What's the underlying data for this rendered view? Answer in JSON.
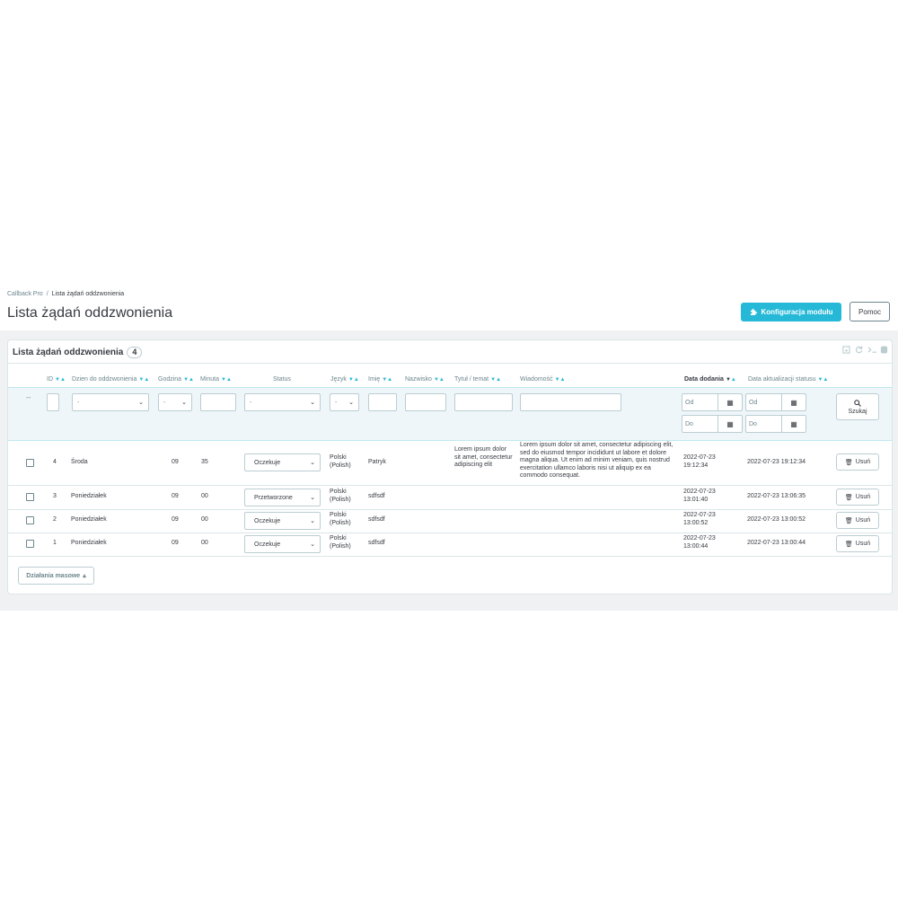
{
  "breadcrumb": {
    "parent": "Callback Pro",
    "separator": "/",
    "current": "Lista żądań oddzwonienia"
  },
  "page_title": "Lista żądań oddzwonienia",
  "toolbar": {
    "config_label": "Konfiguracja modułu",
    "help_label": "Pomoc"
  },
  "panel": {
    "title": "Lista żądań oddzwonienia",
    "count": "4"
  },
  "columns": {
    "id": "ID",
    "day": "Dzien do oddzwonienia",
    "hour": "Godzina",
    "minute": "Minuta",
    "status": "Status",
    "lang": "Język",
    "name": "Imię",
    "surname": "Nazwisko",
    "subject": "Tytuł / temat",
    "message": "Wiadomość",
    "date_add": "Data dodania",
    "date_upd": "Data aktualizacji statusu"
  },
  "filters": {
    "reset": "--",
    "select_placeholder": "-",
    "date_from": "Od",
    "date_to": "Do",
    "search_label": "Szukaj"
  },
  "rows": [
    {
      "id": "4",
      "day": "Środa",
      "hour": "09",
      "minute": "35",
      "status": "Oczekuje",
      "lang_line1": "Polski",
      "lang_line2": "(Polish)",
      "name": "Patryk",
      "subject": "Lorem ipsum dolor sit amet, consectetur adipiscing elit",
      "message": "Lorem ipsum dolor sit amet, consectetur adipiscing elit, sed do eiusmod tempor incididunt ut labore et dolore magna aliqua. Ut enim ad minim veniam, quis nostrud exercitation ullamco laboris nisi ut aliquip ex ea commodo consequat.",
      "date_add_line1": "2022-07-23",
      "date_add_line2": "19:12:34",
      "date_upd": "2022-07-23 19:12:34"
    },
    {
      "id": "3",
      "day": "Poniedziałek",
      "hour": "09",
      "minute": "00",
      "status": "Przetworzone",
      "lang_line1": "Polski",
      "lang_line2": "(Polish)",
      "name": "sdfsdf",
      "subject": "",
      "message": "",
      "date_add_line1": "2022-07-23",
      "date_add_line2": "13:01:40",
      "date_upd": "2022-07-23 13:06:35"
    },
    {
      "id": "2",
      "day": "Poniedziałek",
      "hour": "09",
      "minute": "00",
      "status": "Oczekuje",
      "lang_line1": "Polski",
      "lang_line2": "(Polish)",
      "name": "sdfsdf",
      "subject": "",
      "message": "",
      "date_add_line1": "2022-07-23",
      "date_add_line2": "13:00:52",
      "date_upd": "2022-07-23 13:00:52"
    },
    {
      "id": "1",
      "day": "Poniedziałek",
      "hour": "09",
      "minute": "00",
      "status": "Oczekuje",
      "lang_line1": "Polski",
      "lang_line2": "(Polish)",
      "name": "sdfsdf",
      "subject": "",
      "message": "",
      "date_add_line1": "2022-07-23",
      "date_add_line2": "13:00:44",
      "date_upd": "2022-07-23 13:00:44"
    }
  ],
  "delete_label": "Usuń",
  "bulk_label": "Działania masowe",
  "colors": {
    "accent": "#25b9d7",
    "text": "#363a41",
    "muted": "#6c868e",
    "border": "#bbcdd2"
  }
}
